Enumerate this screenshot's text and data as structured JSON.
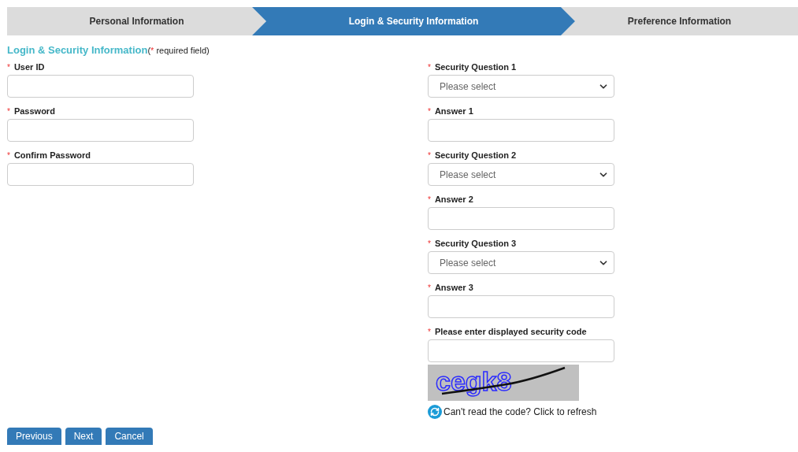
{
  "steps": [
    {
      "label": "Personal Information",
      "selected": false
    },
    {
      "label": "Login & Security Information",
      "selected": true
    },
    {
      "label": "Preference Information",
      "selected": false
    }
  ],
  "section": {
    "title": "Login & Security Information",
    "note_open": "(",
    "note_mark": "*",
    "note_text": " required field)"
  },
  "left_fields": [
    {
      "kind": "text",
      "mark": "*",
      "label": "User ID"
    },
    {
      "kind": "text",
      "mark": "*",
      "label": "Password"
    },
    {
      "kind": "text",
      "mark": "*",
      "label": "Confirm Password"
    }
  ],
  "right_fields": [
    {
      "kind": "select",
      "mark": "*",
      "label": "Security Question 1",
      "placeholder": "Please select"
    },
    {
      "kind": "text",
      "mark": "*",
      "label": "Answer 1"
    },
    {
      "kind": "select",
      "mark": "*",
      "label": "Security Question 2",
      "placeholder": "Please select"
    },
    {
      "kind": "text",
      "mark": "*",
      "label": "Answer 2"
    },
    {
      "kind": "select",
      "mark": "*",
      "label": "Security Question 3",
      "placeholder": "Please select"
    },
    {
      "kind": "text",
      "mark": "*",
      "label": "Answer 3"
    },
    {
      "kind": "text",
      "mark": "*",
      "label": "Please enter displayed security code"
    }
  ],
  "captcha": {
    "code": "cegk8",
    "refresh_text": "Can't read the code? Click to refresh"
  },
  "buttons": [
    "Previous",
    "Next",
    "Cancel"
  ]
}
